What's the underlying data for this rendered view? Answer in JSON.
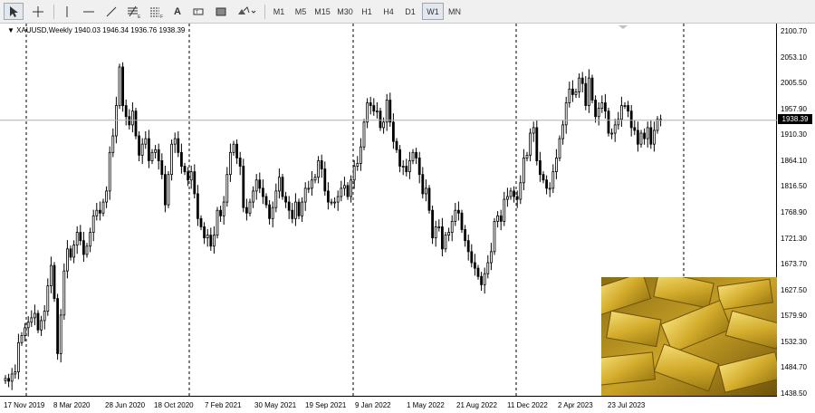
{
  "toolbar": {
    "timeframes": [
      "M1",
      "M5",
      "M15",
      "M30",
      "H1",
      "H4",
      "D1",
      "W1",
      "MN"
    ],
    "active_timeframe": "W1",
    "text_tool": "A",
    "icons": [
      "cursor-arrow-icon",
      "crosshair-icon",
      "vertical-line-icon",
      "horizontal-line-icon",
      "trendline-icon",
      "fibonacci-icon",
      "channel-icon",
      "text-icon",
      "label-icon",
      "shapes-icon"
    ]
  },
  "symbol": {
    "header": "XAUUSD,Weekly  1940.03 1946.34 1936.76 1938.39"
  },
  "current_price": "1938.39",
  "price_axis": [
    "2100.70",
    "2053.10",
    "2005.50",
    "1957.90",
    "1910.30",
    "1864.10",
    "1816.50",
    "1768.90",
    "1721.30",
    "1673.70",
    "1627.50",
    "1579.90",
    "1532.30",
    "1484.70",
    "1438.50"
  ],
  "date_axis": [
    "17 Nov 2019",
    "8 Mar 2020",
    "28 Jun 2020",
    "18 Oct 2020",
    "7 Feb 2021",
    "30 May 2021",
    "19 Sep 2021",
    "9 Jan 2022",
    "1 May 2022",
    "21 Aug 2022",
    "11 Dec 2022",
    "2 Apr 2023",
    "23 Jul 2023"
  ],
  "colors": {
    "bull": "#ffffff",
    "bear": "#000000",
    "grid": "#000000",
    "gold": "#c9a227"
  },
  "chart_data": {
    "type": "candlestick",
    "symbol": "XAUUSD",
    "timeframe": "Weekly",
    "last": {
      "open": 1940.03,
      "high": 1946.34,
      "low": 1936.76,
      "close": 1938.39
    },
    "y_range": [
      1438.5,
      2100.7
    ],
    "closes": [
      1470,
      1465,
      1478,
      1482,
      1535,
      1548,
      1562,
      1572,
      1580,
      1588,
      1558,
      1575,
      1592,
      1638,
      1675,
      1615,
      1515,
      1585,
      1665,
      1705,
      1690,
      1712,
      1735,
      1720,
      1695,
      1710,
      1735,
      1765,
      1775,
      1770,
      1790,
      1810,
      1880,
      1910,
      1965,
      2035,
      1965,
      1945,
      1930,
      1955,
      1910,
      1875,
      1895,
      1905,
      1865,
      1880,
      1885,
      1865,
      1840,
      1785,
      1840,
      1895,
      1905,
      1880,
      1855,
      1845,
      1830,
      1845,
      1805,
      1760,
      1745,
      1725,
      1730,
      1710,
      1730,
      1775,
      1765,
      1790,
      1840,
      1880,
      1895,
      1870,
      1855,
      1780,
      1770,
      1790,
      1810,
      1830,
      1815,
      1800,
      1785,
      1760,
      1780,
      1810,
      1835,
      1800,
      1790,
      1775,
      1760,
      1790,
      1765,
      1790,
      1815,
      1815,
      1830,
      1835,
      1865,
      1850,
      1810,
      1790,
      1790,
      1790,
      1800,
      1815,
      1820,
      1800,
      1830,
      1855,
      1860,
      1890,
      1935,
      1970,
      1965,
      1955,
      1955,
      1925,
      1935,
      1975,
      1935,
      1900,
      1885,
      1855,
      1855,
      1845,
      1865,
      1880,
      1870,
      1840,
      1805,
      1815,
      1775,
      1725,
      1745,
      1745,
      1705,
      1730,
      1735,
      1755,
      1775,
      1770,
      1740,
      1720,
      1700,
      1680,
      1670,
      1655,
      1640,
      1660,
      1680,
      1700,
      1755,
      1765,
      1755,
      1795,
      1800,
      1810,
      1800,
      1795,
      1825,
      1870,
      1875,
      1915,
      1925,
      1865,
      1840,
      1830,
      1815,
      1815,
      1845,
      1870,
      1905,
      1930,
      1970,
      1995,
      1985,
      1990,
      2015,
      2005,
      1965,
      2015,
      1975,
      1945,
      1960,
      1970,
      1955,
      1915,
      1915,
      1930,
      1940,
      1965,
      1965,
      1955,
      1925,
      1920,
      1895,
      1915,
      1905,
      1925,
      1895,
      1920,
      1940,
      1938.39
    ]
  }
}
